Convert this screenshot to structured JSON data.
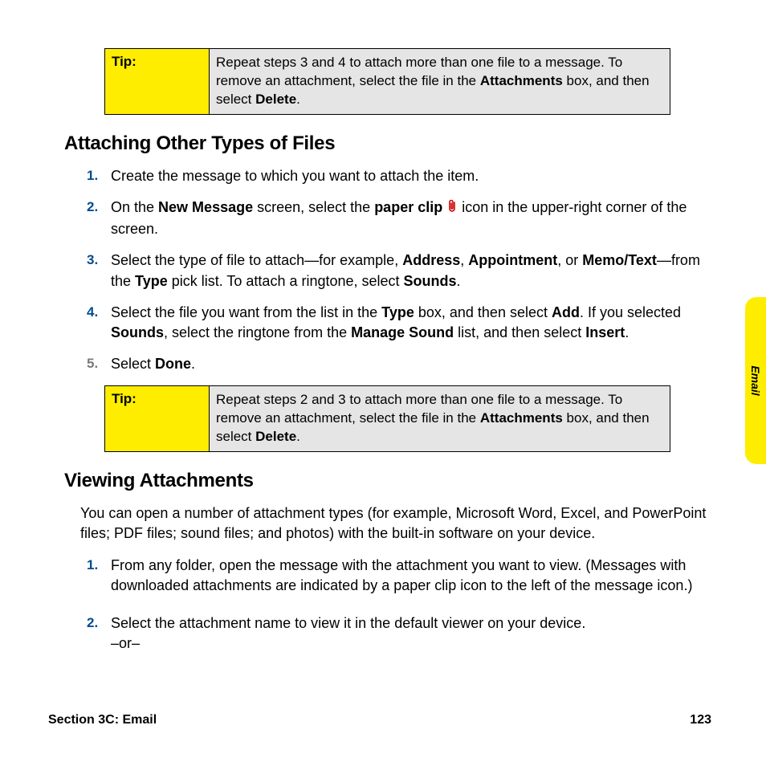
{
  "side_tab": "Email",
  "footer": {
    "section": "Section 3C: Email",
    "page": "123"
  },
  "tip1": {
    "label": "Tip:",
    "text_parts": [
      "Repeat steps 3 and 4 to attach more than one file to a message. To remove an  attachment, select the file in the ",
      "Attachments",
      " box, and then select ",
      "Delete",
      ". "
    ]
  },
  "h1": "Attaching Other Types of Files",
  "steps1": {
    "n1": "1.",
    "s1": "Create the message to which you want to attach the item.",
    "n2": "2.",
    "s2a": "On the ",
    "s2b": "New Message",
    "s2c": " screen, select the ",
    "s2d": "paper clip",
    "s2e": " icon in the upper-right corner of the screen.",
    "n3": "3.",
    "s3a": "Select the type of file to attach—for example, ",
    "s3b": "Address",
    "s3c": ", ",
    "s3d": "Appointment",
    "s3e": ", or ",
    "s3f": "Memo/Text",
    "s3g": "—from the ",
    "s3h": "Type",
    "s3i": " pick list. To attach a ringtone, select ",
    "s3j": "Sounds",
    "s3k": ".",
    "n4": "4.",
    "s4a": "Select the file you want from the list in the ",
    "s4b": "Type",
    "s4c": " box, and then select ",
    "s4d": "Add",
    "s4e": ". If you selected ",
    "s4f": "Sounds",
    "s4g": ", select the ringtone from the ",
    "s4h": "Manage Sound",
    "s4i": " list, and then select ",
    "s4j": "Insert",
    "s4k": ".",
    "n5": "5.",
    "s5a": "Select ",
    "s5b": "Done",
    "s5c": "."
  },
  "tip2": {
    "label": "Tip:",
    "text_parts": [
      "Repeat steps 2 and 3 to attach more than one file to a message. To remove an  attachment, select the file in the ",
      "Attachments",
      " box, and then select ",
      "Delete",
      ". "
    ]
  },
  "h2": "Viewing Attachments",
  "intro": "You can open a number of attachment types (for example, Microsoft Word, Excel, and PowerPoint files; PDF files; sound files; and photos) with the built-in software on your device.",
  "steps2": {
    "n1": "1.",
    "s1": "From any folder, open the message with the attachment you want to view. (Messages with downloaded attachments are indicated by a paper clip icon to the left of the message icon.)",
    "n2": "2.",
    "s2a": "Select the attachment name to view it in the default viewer on your device.",
    "s2b": "–or–"
  }
}
